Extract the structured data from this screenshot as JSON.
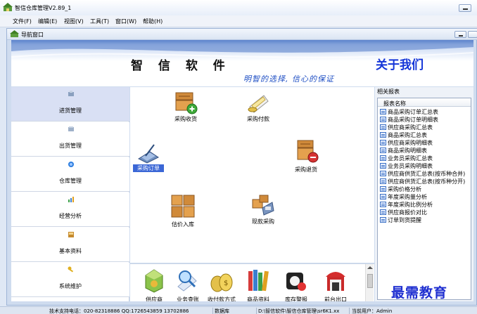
{
  "app": {
    "title": "智信仓库管理V2.89_1"
  },
  "menu": [
    "文件(F)",
    "编辑(E)",
    "视图(V)",
    "工具(T)",
    "窗口(W)",
    "帮助(H)"
  ],
  "child_window": {
    "title": "导航窗口"
  },
  "banner": {
    "title": "智 信 软 件",
    "slogan": "明智的选择, 信心的保证",
    "about": "关于我们"
  },
  "nav": [
    {
      "label": "进货管理",
      "active": true
    },
    {
      "label": "出货管理"
    },
    {
      "label": "仓库管理"
    },
    {
      "label": "经营分析"
    },
    {
      "label": "基本资料"
    },
    {
      "label": "系统维护"
    }
  ],
  "functions": {
    "purchase_receive": "采购收货",
    "purchase_payment": "采购付款",
    "purchase_order": "采购订单",
    "purchase_return": "采购退货",
    "estimated_inbound": "估价入库",
    "cash_purchase": "现款采购"
  },
  "toolbar": [
    "供应商",
    "业务查账",
    "收付款方式",
    "商品资料",
    "库存警报",
    "前台出口"
  ],
  "reports": {
    "panel_title": "相关报表",
    "column_header": "报表名称",
    "items": [
      "商品采购订单汇总表",
      "商品采购订单明细表",
      "供应商采购汇总表",
      "商品采购汇总表",
      "供应商采购明细表",
      "商品采购明细表",
      "业务员采购汇总表",
      "业务员采购明细表",
      "供应商供货汇总表(按币种合并)",
      "供应商供货汇总表(按币种分开)",
      "采购价格分析",
      "年度采购量分析",
      "年度采购比例分析",
      "供应商报价对比",
      "订单到货提醒"
    ]
  },
  "status": {
    "support": "技术支持电话：020-82318886 QQ:1726543859 13702886",
    "db": "数据库",
    "path": "D:\\智信软件\\智信仓库管理\\sr6K1.xx",
    "user": "当前用户：Admin"
  },
  "watermark": "最需教育"
}
